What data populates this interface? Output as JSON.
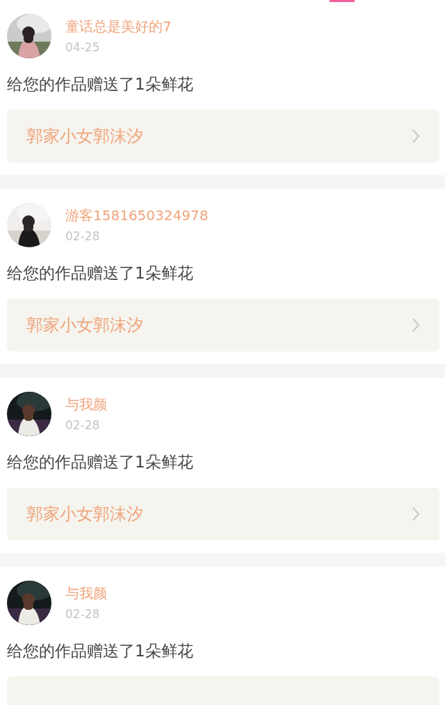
{
  "items": [
    {
      "user": "童话总是美好的7",
      "date": "04-25",
      "message": "给您的作品赠送了1朵鲜花",
      "work": "郭家小女郭沫汐"
    },
    {
      "user": "游客1581650324978",
      "date": "02-28",
      "message": "给您的作品赠送了1朵鲜花",
      "work": "郭家小女郭沫汐"
    },
    {
      "user": "与我颜",
      "date": "02-28",
      "message": "给您的作品赠送了1朵鲜花",
      "work": "郭家小女郭沫汐"
    },
    {
      "user": "与我颜",
      "date": "02-28",
      "message": "给您的作品赠送了1朵鲜花"
    }
  ]
}
